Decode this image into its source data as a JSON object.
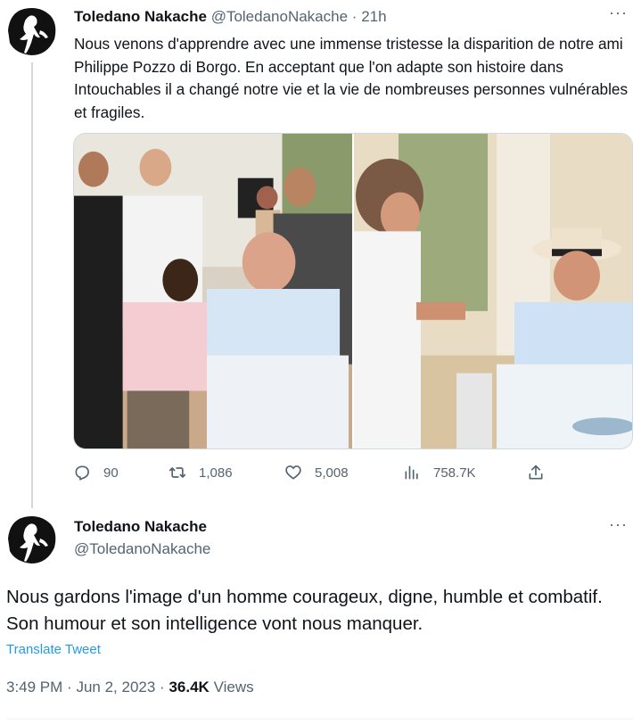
{
  "tweet1": {
    "author_name": "Toledano Nakache",
    "handle": "@ToledanoNakache",
    "separator": "·",
    "time": "21h",
    "more": "···",
    "text": "Nous venons d'apprendre avec une immense tristesse la disparition de notre ami Philippe Pozzo di Borgo. En acceptant que l'on adapte son histoire dans Intouchables il a changé notre vie et la vie de nombreuses personnes vulnérables et fragiles.",
    "replies": "90",
    "retweets": "1,086",
    "likes": "5,008",
    "views": "758.7K"
  },
  "tweet2": {
    "author_name": "Toledano Nakache",
    "handle": "@ToledanoNakache",
    "more": "···",
    "text": "Nous gardons l'image d'un homme courageux, digne, humble et combatif. Son humour et son intelligence vont nous manquer.",
    "translate_label": "Translate Tweet",
    "time": "3:49 PM",
    "separator": "·",
    "date": "Jun 2, 2023",
    "views_count": "36.4K",
    "views_label": "Views"
  },
  "colors": {
    "text_primary": "#0f1419",
    "text_secondary": "#536471",
    "link": "#1d9bf0",
    "border": "#cfd9de"
  },
  "icons": [
    "reply-icon",
    "retweet-icon",
    "like-icon",
    "views-icon",
    "share-icon",
    "more-icon"
  ]
}
